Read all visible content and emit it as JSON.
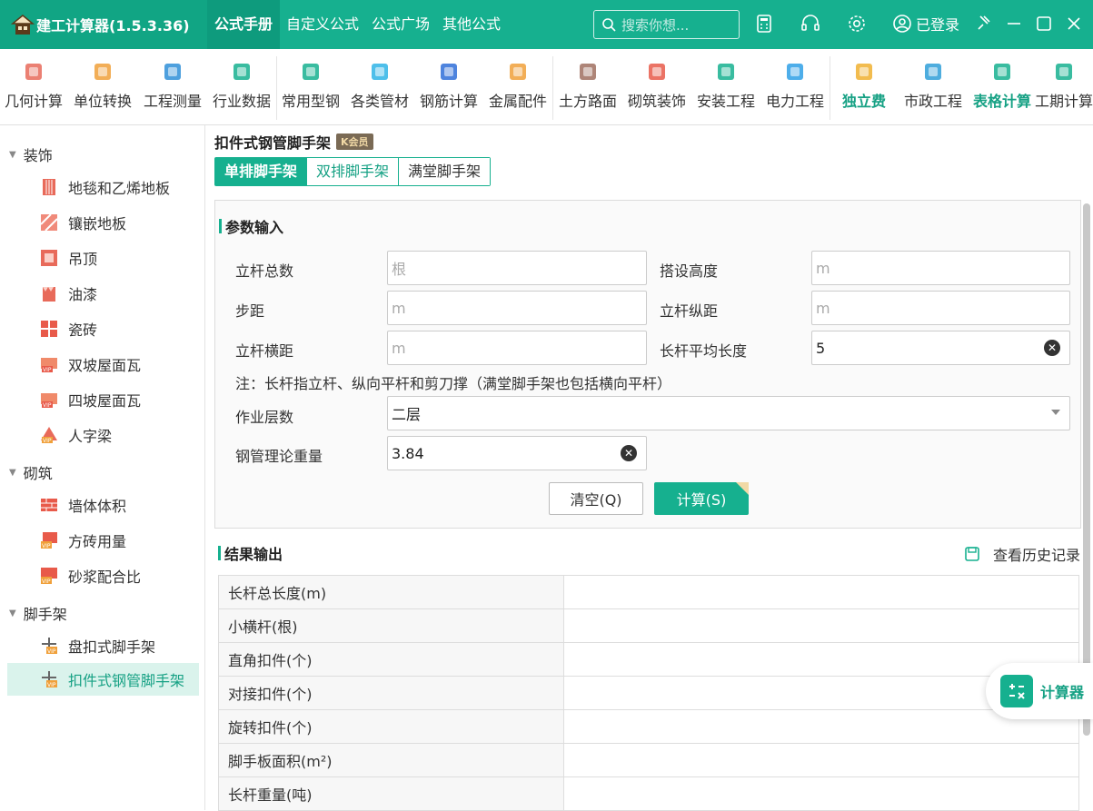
{
  "app": {
    "title": "建工计算器(1.5.3.36)"
  },
  "nav": [
    "公式手册",
    "自定义公式",
    "公式广场",
    "其他公式"
  ],
  "search": {
    "placeholder": "搜索你想..."
  },
  "login_label": "已登录",
  "toolbar": [
    {
      "label": "几何计算",
      "icon": "cube-icon",
      "color": "#e86a5a"
    },
    {
      "label": "单位转换",
      "icon": "unit-convert-icon",
      "color": "#f0a03a"
    },
    {
      "label": "工程测量",
      "icon": "axis-measure-icon",
      "color": "#2f8fd8"
    },
    {
      "label": "行业数据",
      "icon": "bar-chart-icon",
      "color": "#16b08f"
    },
    {
      "label": "常用型钢",
      "icon": "tools-icon",
      "color": "#16b08f"
    },
    {
      "label": "各类管材",
      "icon": "pipe-icon",
      "color": "#2fb4e6"
    },
    {
      "label": "钢筋计算",
      "icon": "rebar-icon",
      "color": "#2f6fd8"
    },
    {
      "label": "金属配件",
      "icon": "metal-fitting-icon",
      "color": "#f0a03a"
    },
    {
      "label": "土方路面",
      "icon": "earthwork-icon",
      "color": "#a07060"
    },
    {
      "label": "砌筑装饰",
      "icon": "brick-icon",
      "color": "#e85a4a"
    },
    {
      "label": "安装工程",
      "icon": "fan-icon",
      "color": "#16b08f"
    },
    {
      "label": "电力工程",
      "icon": "power-house-icon",
      "color": "#2fa0e6"
    },
    {
      "label": "独立费",
      "icon": "independent-fee-icon",
      "color": "#f0b030"
    },
    {
      "label": "市政工程",
      "icon": "municipal-icon",
      "color": "#2f9fd8"
    },
    {
      "label": "表格计算",
      "icon": "vip-ai-table-icon",
      "color": "#16b08f"
    },
    {
      "label": "工期计算",
      "icon": "calendar-icon",
      "color": "#16b08f"
    }
  ],
  "sidebar": {
    "categories": [
      {
        "label": "装饰",
        "items": [
          "地毯和乙烯地板",
          "镶嵌地板",
          "吊顶",
          "油漆",
          "瓷砖",
          "双坡屋面瓦",
          "四坡屋面瓦",
          "人字梁"
        ]
      },
      {
        "label": "砌筑",
        "items": [
          "墙体体积",
          "方砖用量",
          "砂浆配合比"
        ]
      },
      {
        "label": "脚手架",
        "items": [
          "盘扣式脚手架",
          "扣件式钢管脚手架"
        ]
      }
    ]
  },
  "main": {
    "title": "扣件式钢管脚手架",
    "vip_badge": "K会员",
    "tabs": [
      "单排脚手架",
      "双排脚手架",
      "满堂脚手架"
    ],
    "input_section": "参数输入",
    "fields": {
      "pole_count": {
        "label": "立杆总数",
        "placeholder": "根",
        "value": ""
      },
      "height": {
        "label": "搭设高度",
        "placeholder": "m",
        "value": ""
      },
      "step": {
        "label": "步距",
        "placeholder": "m",
        "value": ""
      },
      "long_spacing": {
        "label": "立杆纵距",
        "placeholder": "m",
        "value": ""
      },
      "cross_spacing": {
        "label": "立杆横距",
        "placeholder": "m",
        "value": ""
      },
      "avg_length": {
        "label": "长杆平均长度",
        "value": "5"
      },
      "layers": {
        "label": "作业层数",
        "value": "二层"
      },
      "weight": {
        "label": "钢管理论重量",
        "value": "3.84"
      }
    },
    "note": "注：长杆指立杆、纵向平杆和剪刀撑（满堂脚手架也包括横向平杆）",
    "clear_button": "清空(Q)",
    "calc_button": "计算(S)",
    "output_section": "结果输出",
    "history_link": "查看历史记录",
    "results": [
      {
        "label": "长杆总长度(m)",
        "value": ""
      },
      {
        "label": "小横杆(根)",
        "value": ""
      },
      {
        "label": "直角扣件(个)",
        "value": ""
      },
      {
        "label": "对接扣件(个)",
        "value": ""
      },
      {
        "label": "旋转扣件(个)",
        "value": ""
      },
      {
        "label": "脚手板面积(m²)",
        "value": ""
      },
      {
        "label": "长杆重量(吨)",
        "value": ""
      }
    ]
  },
  "float_calc": {
    "label": "计算器"
  },
  "accent": "#16b08f"
}
